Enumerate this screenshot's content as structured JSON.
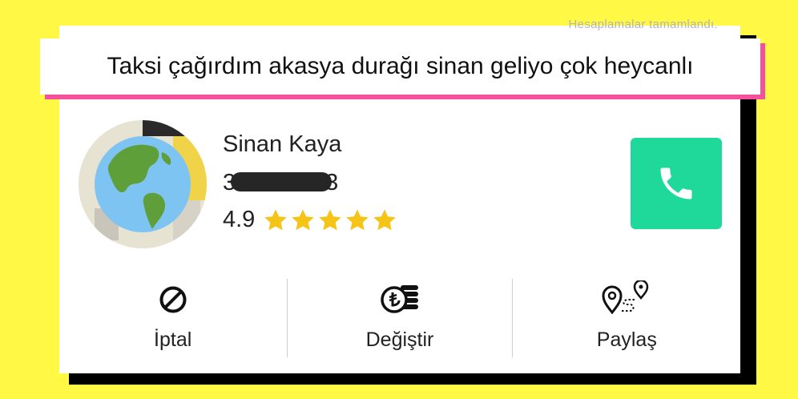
{
  "caption": "Taksi çağırdım akasya durağı sinan geliyo çok heycanlı",
  "faded_header": "Hesaplamalar tamamlandı.",
  "driver": {
    "name": "Sinan Kaya",
    "plate_start": "3",
    "plate_end": "3",
    "rating": "4.9",
    "stars": 5
  },
  "actions": {
    "cancel_label": "İptal",
    "change_label": "Değiştir",
    "share_label": "Paylaş"
  },
  "icons": {
    "avatar": "globe-icon",
    "call": "phone-icon",
    "cancel": "prohibited-icon",
    "change": "lira-coins-icon",
    "share": "route-pins-icon",
    "rating": "star-icon"
  },
  "colors": {
    "background": "#FFF945",
    "caption_shadow": "#F4509C",
    "call_button": "#1ED99A",
    "star": "#F6C416"
  }
}
